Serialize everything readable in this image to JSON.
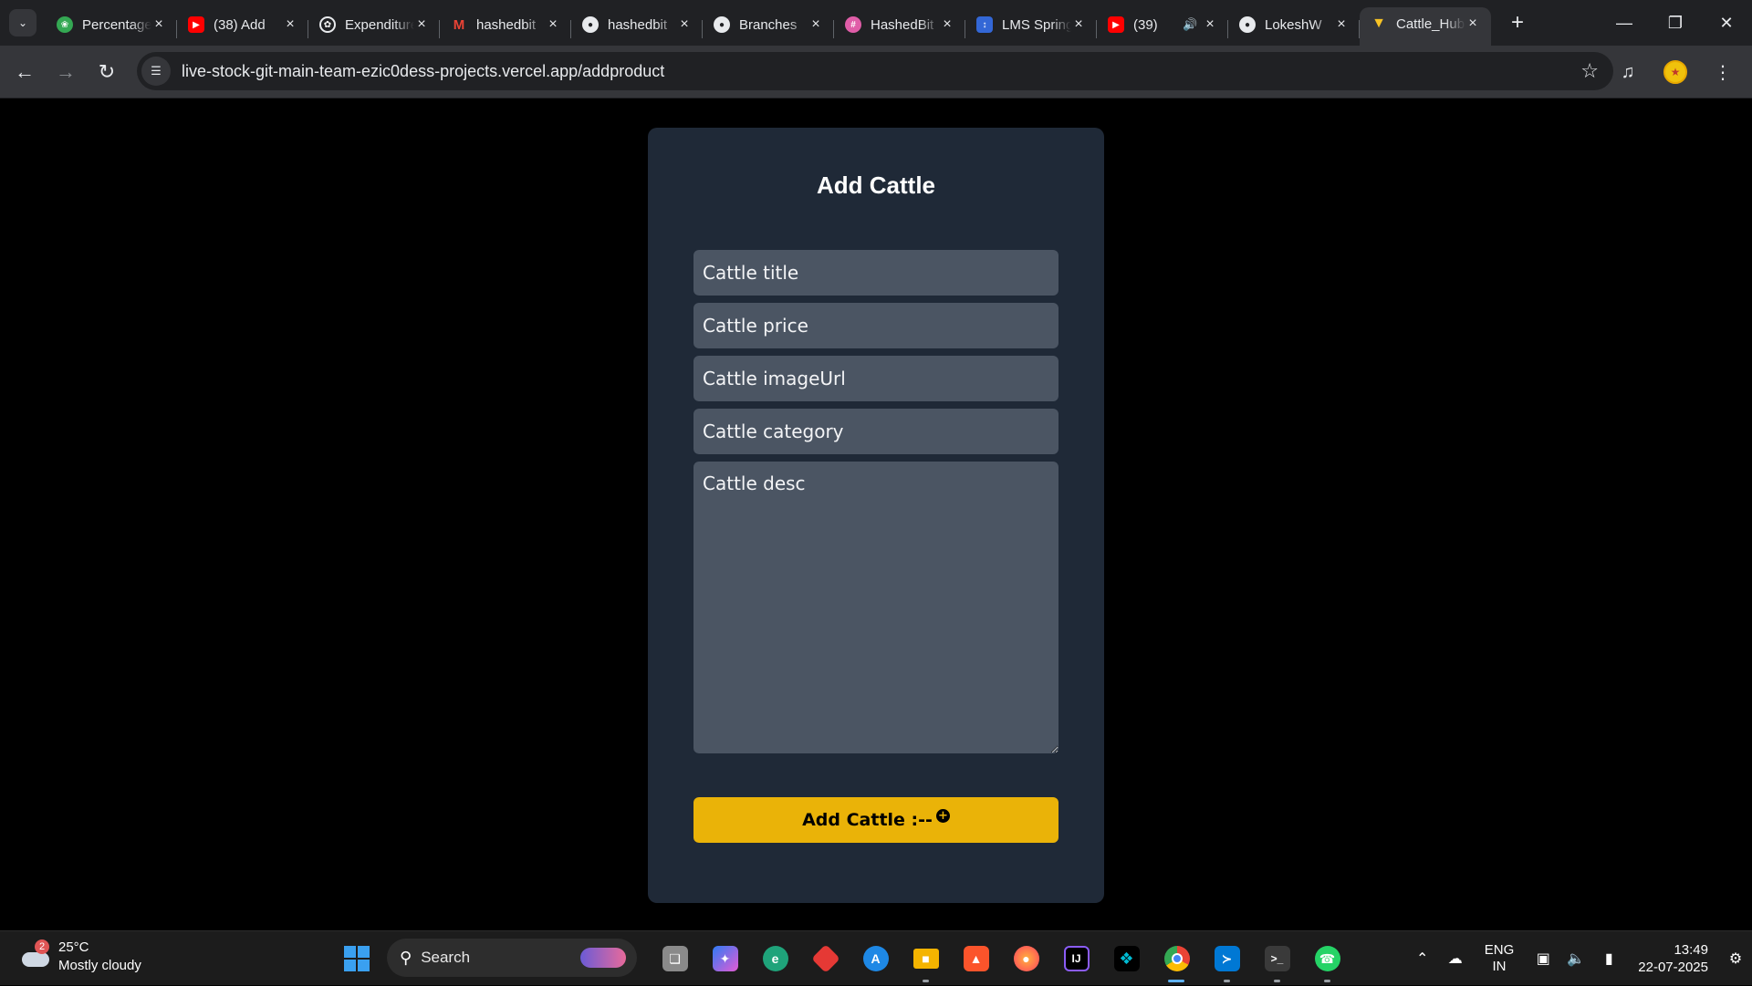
{
  "browser": {
    "tab_search_icon": "chevron-down-icon",
    "tabs": [
      {
        "title": "Percentage",
        "favicon": "leaf-icon",
        "color": "#34a853",
        "active": false
      },
      {
        "title": "(38) Add",
        "favicon": "youtube-icon",
        "color": "#ff0000",
        "active": false
      },
      {
        "title": "Expenditure",
        "favicon": "openai-icon",
        "color": "#8e8ea0",
        "active": false
      },
      {
        "title": "hashedbit",
        "favicon": "gmail-icon",
        "color": "#ea4335",
        "active": false
      },
      {
        "title": "hashedbit",
        "favicon": "github-icon",
        "color": "#ffffff",
        "active": false
      },
      {
        "title": "Branches",
        "favicon": "github-icon",
        "color": "#ffffff",
        "active": false
      },
      {
        "title": "HashedBit",
        "favicon": "hashedbit-icon",
        "color": "#e05da8",
        "active": false
      },
      {
        "title": "LMS Spring",
        "favicon": "lms-icon",
        "color": "#3367d6",
        "active": false
      },
      {
        "title": "(39)",
        "favicon": "youtube-icon",
        "color": "#ff0000",
        "active": false,
        "audio": true
      },
      {
        "title": "LokeshW",
        "favicon": "github-icon",
        "color": "#ffffff",
        "active": false
      },
      {
        "title": "Cattle_Hub",
        "favicon": "vite-icon",
        "color": "#a855f7",
        "active": true
      }
    ],
    "url": "live-stock-git-main-team-ezic0dess-projects.vercel.app",
    "url_path": "/addproduct"
  },
  "form": {
    "title": "Add Cattle",
    "fields": {
      "title_placeholder": "Cattle title",
      "price_placeholder": "Cattle price",
      "image_placeholder": "Cattle imageUrl",
      "category_placeholder": "Cattle category",
      "desc_placeholder": "Cattle desc"
    },
    "submit_label": "Add Cattle :--",
    "submit_icon": "plus-circle-icon",
    "colors": {
      "card": "#1f2937",
      "input": "#4b5563",
      "button": "#eab308"
    }
  },
  "taskbar": {
    "weather": {
      "temp": "25°C",
      "condition": "Mostly cloudy",
      "badge": "2"
    },
    "search_label": "Search",
    "apps": [
      {
        "name": "task-view",
        "icon": "task-view-icon",
        "color": "#8a8a8a"
      },
      {
        "name": "copilot",
        "icon": "copilot-icon",
        "color": "#6f5cf0"
      },
      {
        "name": "edge",
        "icon": "edge-icon",
        "color": "#1fa37a"
      },
      {
        "name": "git-kraken",
        "icon": "diamond-icon",
        "color": "#e53935"
      },
      {
        "name": "app-store",
        "icon": "app-store-icon",
        "color": "#1e88e5"
      },
      {
        "name": "file-explorer",
        "icon": "folder-icon",
        "color": "#f4b400"
      },
      {
        "name": "brave",
        "icon": "brave-icon",
        "color": "#fb542b"
      },
      {
        "name": "firefox",
        "icon": "firefox-icon",
        "color": "#ff7139"
      },
      {
        "name": "intellij",
        "icon": "intellij-icon",
        "color": "#3b3bdb"
      },
      {
        "name": "teal-app",
        "icon": "puzzle-icon",
        "color": "#00bcd4"
      },
      {
        "name": "chrome",
        "icon": "chrome-icon",
        "color": "#34a853"
      },
      {
        "name": "vscode",
        "icon": "vscode-icon",
        "color": "#0078d4"
      },
      {
        "name": "terminal",
        "icon": "terminal-icon",
        "color": "#444444"
      },
      {
        "name": "whatsapp",
        "icon": "whatsapp-icon",
        "color": "#25d366"
      }
    ],
    "lang_line1": "ENG",
    "lang_line2": "IN",
    "time": "13:49",
    "date": "22-07-2025"
  }
}
